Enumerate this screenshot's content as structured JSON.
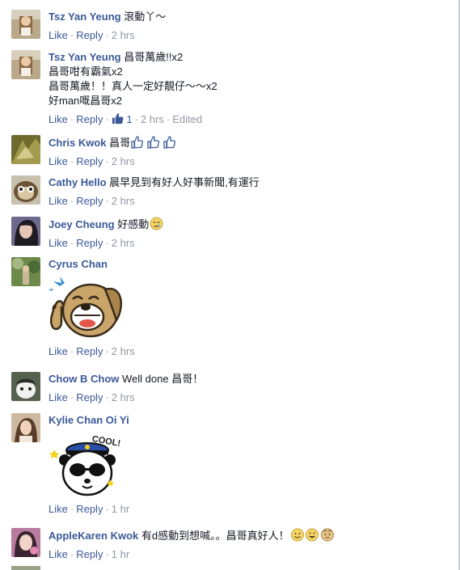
{
  "comments": [
    {
      "name": "Tsz Yan Yeung",
      "lines": [
        "滾動丫～"
      ],
      "like": "Like",
      "reply": "Reply",
      "time": "2 hrs"
    },
    {
      "name": "Tsz Yan Yeung",
      "lines": [
        "昌哥萬歲!!x2",
        "昌哥咁有霸氣x2",
        "昌哥萬歲！！真人一定好靚仔～～x2",
        "好man嘅昌哥x2"
      ],
      "like": "Like",
      "reply": "Reply",
      "like_count": "1",
      "time": "2 hrs",
      "edited": "Edited"
    },
    {
      "name": "Chris Kwok",
      "lines": [
        "昌哥"
      ],
      "like": "Like",
      "reply": "Reply",
      "time": "2 hrs"
    },
    {
      "name": "Cathy Hello",
      "lines": [
        "晨早見到有好人好事新聞,有運行"
      ],
      "like": "Like",
      "reply": "Reply",
      "time": "2 hrs"
    },
    {
      "name": "Joey Cheung",
      "lines": [
        "好感動"
      ],
      "like": "Like",
      "reply": "Reply",
      "time": "2 hrs"
    },
    {
      "name": "Cyrus Chan",
      "lines": [
        ""
      ],
      "like": "Like",
      "reply": "Reply",
      "time": "2 hrs"
    },
    {
      "name": "Chow B Chow",
      "lines": [
        "Well done 昌哥！"
      ],
      "like": "Like",
      "reply": "Reply",
      "time": "2 hrs"
    },
    {
      "name": "Kylie Chan Oi Yi",
      "lines": [
        ""
      ],
      "like": "Like",
      "reply": "Reply",
      "time": "1 hr",
      "sticker_text": "COOL!"
    },
    {
      "name": "AppleKaren Kwok",
      "lines": [
        "有d感動到想喊。。昌哥真好人！"
      ],
      "like": "Like",
      "reply": "Reply",
      "time": "1 hr"
    }
  ],
  "sep": "·",
  "colors": {
    "link": "#3b5998",
    "meta": "#9197a3",
    "text": "#141823"
  }
}
